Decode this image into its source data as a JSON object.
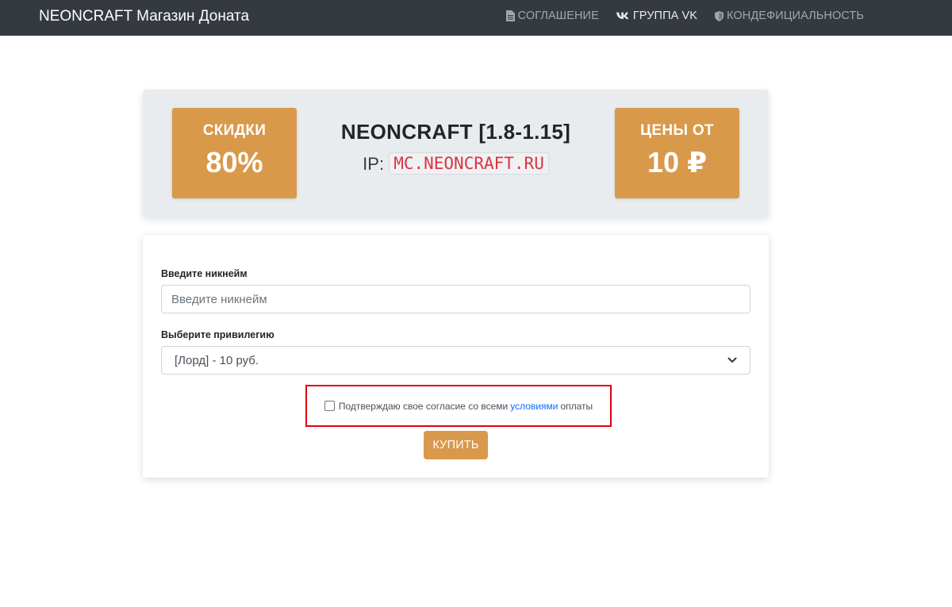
{
  "navbar": {
    "brand": "NEONCRAFT Магазин Доната",
    "links": [
      {
        "label": "СОГЛАШЕНИЕ",
        "icon": "document-icon"
      },
      {
        "label": "ГРУППА VK",
        "icon": "vk-icon"
      },
      {
        "label": "КОНДЕФИЦИАЛЬНОСТЬ",
        "icon": "shield-icon"
      }
    ]
  },
  "hero": {
    "discount_label": "СКИДКИ",
    "discount_value": "80%",
    "server_name": "NEONCRAFT [1.8-1.15]",
    "ip_label": "IP:",
    "ip_value": "MC.NEONCRAFT.RU",
    "price_label": "ЦЕНЫ ОТ",
    "price_value": "10 ₽"
  },
  "form": {
    "nickname_label": "Введите никнейм",
    "nickname_placeholder": "Введите никнейм",
    "nickname_value": "",
    "privilege_label": "Выберите привилегию",
    "privilege_selected": "[Лорд] - 10 руб.",
    "consent_prefix": "Подтверждаю свое согласие со всеми",
    "consent_link": "условиями",
    "consent_suffix": "оплаты",
    "consent_checked": false,
    "buy_label": "КУПИТЬ"
  },
  "colors": {
    "navbar_bg": "#343a40",
    "accent": "#d9994b",
    "hero_bg": "#e9ecef",
    "ip_text": "#dc3545",
    "link": "#0d6efd",
    "highlight_border": "#e0000f"
  }
}
